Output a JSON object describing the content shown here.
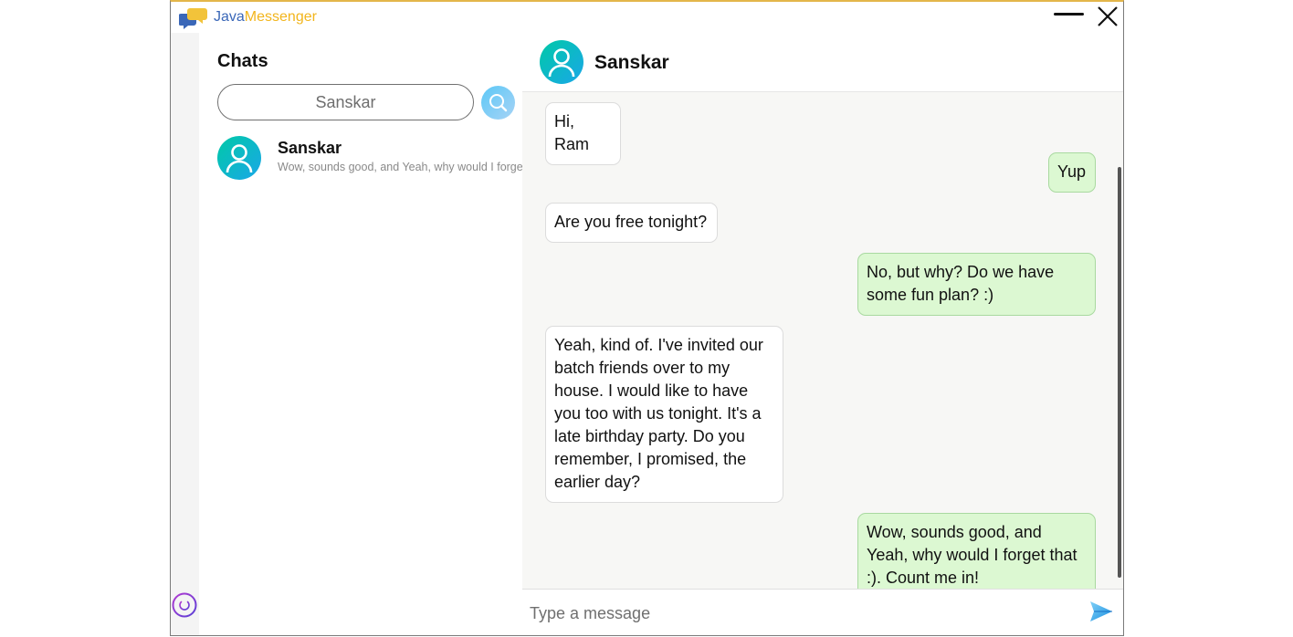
{
  "app": {
    "title_part1": "Java",
    "title_part2": "Messenger"
  },
  "colors": {
    "accent_blue": "#3a67b8",
    "accent_yellow": "#f2b51c",
    "outgoing_bubble": "#dcf8d2",
    "avatar_gradient_start": "#00c9a7",
    "avatar_gradient_end": "#1aa7e8"
  },
  "sidebar": {
    "title": "Chats",
    "search": {
      "value": "Sanskar",
      "placeholder": ""
    },
    "chats": [
      {
        "name": "Sanskar",
        "preview": "Wow, sounds good, and Yeah, why would I forget that :). Count me in!"
      }
    ]
  },
  "conversation": {
    "contact_name": "Sanskar",
    "messages": [
      {
        "direction": "in",
        "text": "Hi, Ram"
      },
      {
        "direction": "out",
        "text": "Yup"
      },
      {
        "direction": "in",
        "text": "Are you free tonight?"
      },
      {
        "direction": "out",
        "text": "No, but why? Do we have some fun plan? :)"
      },
      {
        "direction": "in",
        "text": "Yeah, kind of. I've invited our batch friends over to my house. I would like to have you too with us tonight. It's a late birthday party. Do you remember, I promised, the earlier day?"
      },
      {
        "direction": "out",
        "text": "Wow, sounds good, and Yeah, why would I forget that :). Count me in!"
      }
    ],
    "composer": {
      "placeholder": "Type a message"
    }
  },
  "icons": {
    "logo": "chat-bubbles-logo-icon",
    "minimize": "minimize-icon",
    "close": "close-icon",
    "search": "search-icon",
    "avatar": "user-avatar-icon",
    "power": "power-icon",
    "send": "send-icon"
  }
}
